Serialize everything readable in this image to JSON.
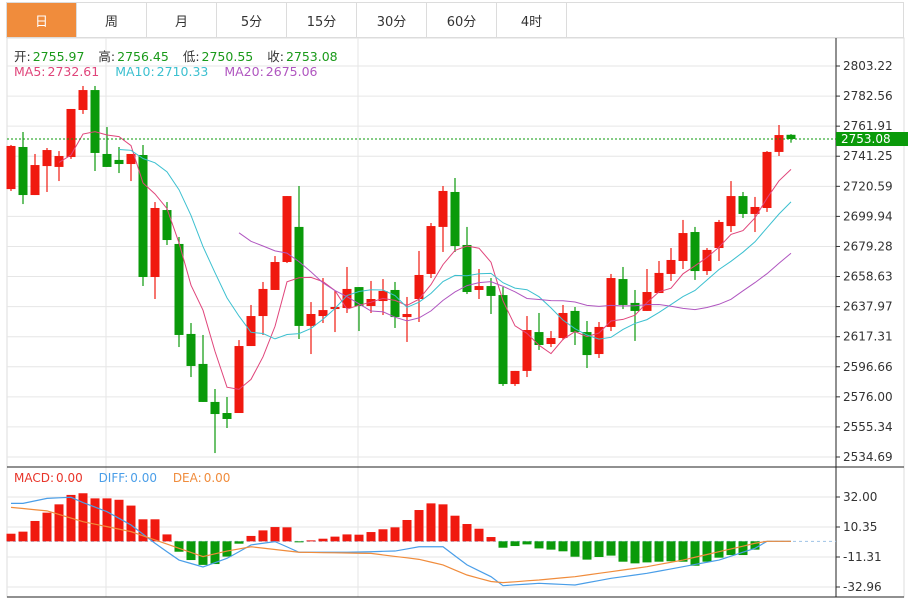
{
  "tabs": [
    {
      "label": "日",
      "active": true
    },
    {
      "label": "周"
    },
    {
      "label": "月"
    },
    {
      "label": "5分"
    },
    {
      "label": "15分"
    },
    {
      "label": "30分"
    },
    {
      "label": "60分"
    },
    {
      "label": "4时"
    }
  ],
  "ohlc_info": {
    "open_label": "开:",
    "open": "2755.97",
    "high_label": "高:",
    "high": "2756.45",
    "low_label": "低:",
    "low": "2750.55",
    "close_label": "收:",
    "close": "2753.08"
  },
  "ma_info": {
    "ma5_label": "MA5:",
    "ma5": "2732.61",
    "ma10_label": "MA10:",
    "ma10": "2710.33",
    "ma20_label": "MA20:",
    "ma20": "2675.06"
  },
  "macd_info": {
    "macd_label": "MACD:",
    "macd": "0.00",
    "diff_label": "DIFF:",
    "diff": "0.00",
    "dea_label": "DEA:",
    "dea": "0.00"
  },
  "colors": {
    "up": "#f0190f",
    "down": "#0a9a0a",
    "accent": "#f08c3c",
    "ma5": "#e0457b",
    "ma10": "#3cc0d0",
    "ma20": "#b056c0",
    "diff": "#4a9ee8",
    "dea": "#f08c3c",
    "last_price": "#0a9a0a"
  },
  "chart_data": [
    {
      "type": "candlestick",
      "ylim": [
        2534.69,
        2803.22
      ],
      "y_ticks": [
        "2803.22",
        "2782.56",
        "2761.91",
        "2741.25",
        "2720.59",
        "2699.94",
        "2679.28",
        "2658.63",
        "2637.97",
        "2617.31",
        "2596.66",
        "2576.00",
        "2555.34",
        "2534.69"
      ],
      "last_price": "2753.08",
      "ma_periods": [
        5,
        10,
        20
      ],
      "candles_ohlc": [
        [
          2718.7,
          2749.0,
          2717.4,
          2748.3
        ],
        [
          2747.6,
          2757.9,
          2708.4,
          2714.6
        ],
        [
          2714.6,
          2742.8,
          2714.6,
          2735.2
        ],
        [
          2734.5,
          2746.9,
          2716.7,
          2745.5
        ],
        [
          2733.9,
          2744.8,
          2724.2,
          2741.4
        ],
        [
          2740.7,
          2773.7,
          2739.4,
          2773.7
        ],
        [
          2773.0,
          2789.5,
          2770.3,
          2786.7
        ],
        [
          2786.7,
          2789.5,
          2731.1,
          2743.5
        ],
        [
          2742.8,
          2761.3,
          2733.9,
          2733.9
        ],
        [
          2738.7,
          2747.6,
          2729.7,
          2735.9
        ],
        [
          2735.9,
          2742.8,
          2724.2,
          2742.8
        ],
        [
          2742.1,
          2749.0,
          2652.1,
          2658.3
        ],
        [
          2658.3,
          2709.8,
          2643.2,
          2705.7
        ],
        [
          2704.3,
          2709.8,
          2680.3,
          2683.7
        ],
        [
          2681.0,
          2685.8,
          2610.2,
          2618.5
        ],
        [
          2619.2,
          2626.7,
          2589.6,
          2597.2
        ],
        [
          2598.6,
          2618.5,
          2572.5,
          2572.5
        ],
        [
          2572.5,
          2581.4,
          2537.4,
          2564.2
        ],
        [
          2564.9,
          2575.9,
          2554.6,
          2560.8
        ],
        [
          2564.9,
          2615.0,
          2564.9,
          2610.9
        ],
        [
          2610.9,
          2639.1,
          2610.9,
          2631.5
        ],
        [
          2631.5,
          2654.9,
          2618.5,
          2650.1
        ],
        [
          2649.4,
          2672.7,
          2649.4,
          2668.6
        ],
        [
          2668.6,
          2713.9,
          2667.9,
          2713.9
        ],
        [
          2692.7,
          2720.8,
          2615.7,
          2624.7
        ],
        [
          2624.7,
          2641.1,
          2605.4,
          2632.9
        ],
        [
          2631.5,
          2657.6,
          2626.7,
          2635.6
        ],
        [
          2636.3,
          2648.7,
          2620.5,
          2637.7
        ],
        [
          2637.0,
          2665.2,
          2633.6,
          2650.1
        ],
        [
          2651.4,
          2651.4,
          2621.2,
          2638.4
        ],
        [
          2638.4,
          2655.6,
          2633.6,
          2643.2
        ],
        [
          2641.8,
          2656.9,
          2632.2,
          2648.7
        ],
        [
          2649.4,
          2654.9,
          2623.3,
          2630.8
        ],
        [
          2630.8,
          2644.6,
          2613.7,
          2632.9
        ],
        [
          2643.2,
          2676.2,
          2627.4,
          2659.7
        ],
        [
          2660.4,
          2695.4,
          2657.6,
          2693.3
        ],
        [
          2692.7,
          2720.8,
          2675.5,
          2717.4
        ],
        [
          2716.7,
          2726.3,
          2675.5,
          2679.6
        ],
        [
          2680.3,
          2692.7,
          2646.6,
          2648.0
        ],
        [
          2649.4,
          2663.8,
          2643.2,
          2652.1
        ],
        [
          2652.1,
          2657.6,
          2632.9,
          2645.3
        ],
        [
          2645.9,
          2651.4,
          2583.5,
          2584.8
        ],
        [
          2584.8,
          2593.8,
          2583.5,
          2593.8
        ],
        [
          2593.8,
          2631.5,
          2589.6,
          2621.9
        ],
        [
          2620.5,
          2633.6,
          2608.2,
          2611.6
        ],
        [
          2612.3,
          2621.2,
          2610.2,
          2616.4
        ],
        [
          2616.4,
          2639.1,
          2615.0,
          2633.6
        ],
        [
          2635.0,
          2637.7,
          2611.6,
          2620.5
        ],
        [
          2620.5,
          2628.1,
          2595.8,
          2604.7
        ],
        [
          2605.4,
          2627.4,
          2602.7,
          2624.0
        ],
        [
          2624.0,
          2660.4,
          2621.2,
          2657.6
        ],
        [
          2656.9,
          2665.2,
          2636.3,
          2639.1
        ],
        [
          2640.5,
          2649.4,
          2614.4,
          2635.0
        ],
        [
          2635.0,
          2663.8,
          2635.0,
          2648.0
        ],
        [
          2647.3,
          2669.3,
          2647.3,
          2661.1
        ],
        [
          2660.4,
          2678.2,
          2655.6,
          2670.0
        ],
        [
          2669.3,
          2697.5,
          2663.8,
          2688.5
        ],
        [
          2689.2,
          2692.7,
          2656.3,
          2662.4
        ],
        [
          2662.4,
          2678.2,
          2659.7,
          2676.9
        ],
        [
          2678.2,
          2697.5,
          2669.3,
          2696.1
        ],
        [
          2693.3,
          2724.2,
          2689.2,
          2713.9
        ],
        [
          2713.9,
          2716.7,
          2698.8,
          2701.6
        ],
        [
          2701.6,
          2713.3,
          2689.2,
          2706.4
        ],
        [
          2705.7,
          2744.8,
          2703.0,
          2744.2
        ],
        [
          2744.2,
          2762.7,
          2741.4,
          2755.8
        ],
        [
          2755.97,
          2756.45,
          2750.55,
          2753.08
        ]
      ]
    },
    {
      "type": "bar+line",
      "ylim": [
        -32.96,
        32.0
      ],
      "y_ticks": [
        "32.00",
        "10.35",
        "-11.31",
        "-32.96"
      ],
      "macd_hist": [
        5.5,
        7,
        14.7,
        20.7,
        26.7,
        33.5,
        34.7,
        31,
        31,
        30,
        25.8,
        15.9,
        15.9,
        5,
        -7.5,
        -13.5,
        -17,
        -16.4,
        -11,
        -1.7,
        3.9,
        7.9,
        10.3,
        10.1,
        -0.3,
        0.7,
        1.9,
        3.4,
        5,
        4.8,
        6.7,
        8.7,
        10.1,
        15.4,
        22.6,
        27.4,
        26.7,
        18.5,
        12.5,
        9.1,
        3.1,
        -4.6,
        -3.4,
        -2.2,
        -5.1,
        -6,
        -7.2,
        -11.1,
        -13.2,
        -11.3,
        -10.3,
        -14.7,
        -15.9,
        -15.2,
        -14.7,
        -14.4,
        -14.7,
        -17.6,
        -14.7,
        -11.8,
        -9.9,
        -9.9,
        -6,
        0,
        0,
        0
      ],
      "diff": [
        27.4,
        27.4,
        29.2,
        31,
        31.4,
        31.8,
        28,
        24.7,
        21.4,
        16.6,
        11.8,
        5.2,
        -1.4,
        -7.5,
        -13.5,
        -16,
        -18.5,
        -15.4,
        -12.3,
        -7.5,
        -2.6,
        -1.4,
        -0.2,
        -4,
        -7.9,
        -7.9,
        -7.9,
        -7.9,
        -7.9,
        -7.7,
        -7.5,
        -7.2,
        -7,
        -5.5,
        -3.9,
        -3.9,
        -3.9,
        -10.5,
        -17,
        -21.3,
        -25.5,
        -32,
        -31.4,
        -30.9,
        -30.3,
        -30.7,
        -31.1,
        -31.5,
        -29.9,
        -28.3,
        -26.7,
        -25.5,
        -24.3,
        -23.1,
        -21.5,
        -19.9,
        -18.3,
        -16.7,
        -15.1,
        -13.5,
        -10.7,
        -7.8,
        -5,
        0,
        0,
        0
      ],
      "dea": [
        24.5,
        23.7,
        22.8,
        22,
        19.4,
        16.8,
        14.2,
        12.4,
        10.6,
        8.8,
        7,
        4,
        1,
        -2,
        -5,
        -8,
        -11,
        -9,
        -7,
        -5.5,
        -3.9,
        -4.9,
        -5.9,
        -6.9,
        -7.9,
        -8.0,
        -8.2,
        -8.3,
        -8.4,
        -8.6,
        -8.7,
        -9.8,
        -10.9,
        -11.9,
        -13,
        -15,
        -17,
        -20.7,
        -24.3,
        -26.7,
        -29,
        -29.8,
        -29.2,
        -28.5,
        -27.9,
        -27.1,
        -26.3,
        -25.5,
        -24.3,
        -23.1,
        -21.9,
        -20.7,
        -19.5,
        -18.3,
        -16.7,
        -15.1,
        -13.5,
        -11.5,
        -9.5,
        -7.5,
        -5.5,
        -3.5,
        -1.4,
        0,
        0,
        0
      ]
    }
  ]
}
